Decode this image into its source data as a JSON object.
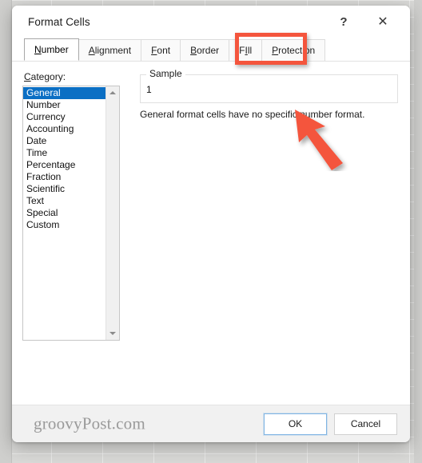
{
  "window": {
    "title": "Format Cells",
    "help_glyph": "?",
    "close_glyph": "✕"
  },
  "tabs": [
    {
      "label": "Number",
      "accel": "N",
      "selected": true,
      "highlighted": false
    },
    {
      "label": "Alignment",
      "accel": "A",
      "selected": false,
      "highlighted": false
    },
    {
      "label": "Font",
      "accel": "F",
      "selected": false,
      "highlighted": false
    },
    {
      "label": "Border",
      "accel": "B",
      "selected": false,
      "highlighted": false
    },
    {
      "label": "Fill",
      "accel": "I",
      "selected": false,
      "highlighted": false
    },
    {
      "label": "Protection",
      "accel": "P",
      "selected": false,
      "highlighted": true
    }
  ],
  "number_tab": {
    "category_label": "Category:",
    "category_accel": "C",
    "categories": [
      {
        "label": "General",
        "selected": true
      },
      {
        "label": "Number",
        "selected": false
      },
      {
        "label": "Currency",
        "selected": false
      },
      {
        "label": "Accounting",
        "selected": false
      },
      {
        "label": "Date",
        "selected": false
      },
      {
        "label": "Time",
        "selected": false
      },
      {
        "label": "Percentage",
        "selected": false
      },
      {
        "label": "Fraction",
        "selected": false
      },
      {
        "label": "Scientific",
        "selected": false
      },
      {
        "label": "Text",
        "selected": false
      },
      {
        "label": "Special",
        "selected": false
      },
      {
        "label": "Custom",
        "selected": false
      }
    ],
    "sample_legend": "Sample",
    "sample_value": "1",
    "description": "General format cells have no specific number format."
  },
  "footer": {
    "ok_label": "OK",
    "cancel_label": "Cancel",
    "watermark": "groovyPost.com"
  },
  "annotation": {
    "target_tab": "Protection",
    "color": "#f4553d",
    "arrow_direction": "up-left"
  },
  "colors": {
    "selection_blue": "#0b6fc4",
    "annotation_red": "#f4553d",
    "dialog_background": "#f1f1f1",
    "panel_white": "#ffffff"
  }
}
